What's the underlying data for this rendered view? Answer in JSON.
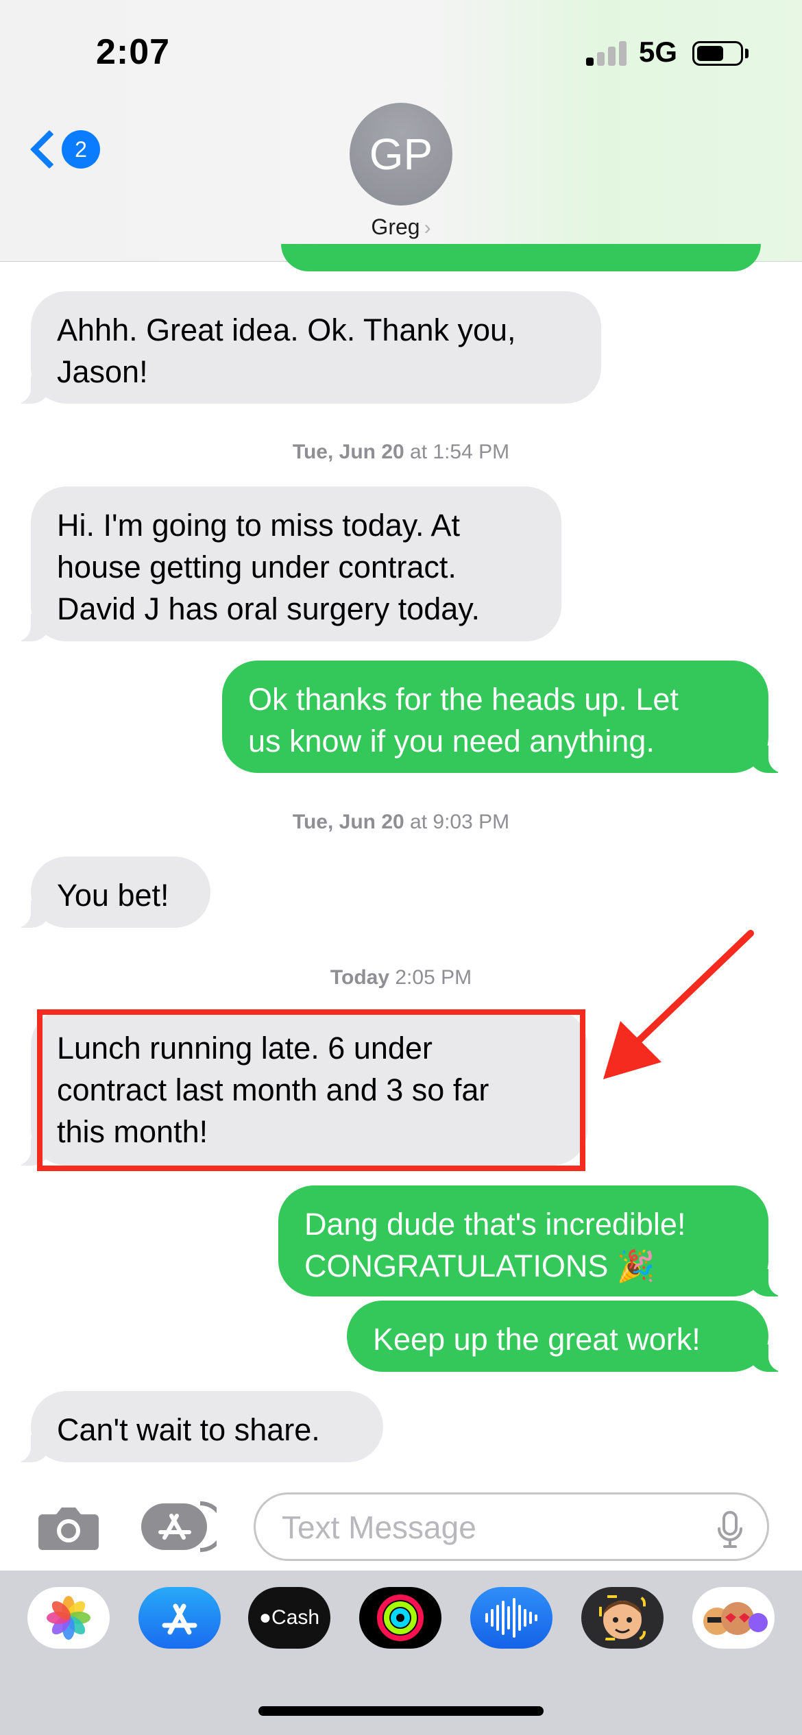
{
  "status_bar": {
    "time": "2:07",
    "network": "5G"
  },
  "header": {
    "back_badge": "2",
    "avatar_initials": "GP",
    "contact_name": "Greg"
  },
  "messages": [
    {
      "kind": "in",
      "text": "Ahhh. Great idea. Ok. Thank you,\nJason!"
    },
    {
      "kind": "timestamp",
      "day": "Tue, Jun 20",
      "time": " at 1:54 PM"
    },
    {
      "kind": "in",
      "text": "Hi. I'm going to miss today. At\nhouse getting under contract.\nDavid J has oral surgery today."
    },
    {
      "kind": "out",
      "text": "Ok thanks for the heads up. Let\nus know if you need anything."
    },
    {
      "kind": "timestamp",
      "day": "Tue, Jun 20",
      "time": " at 9:03 PM"
    },
    {
      "kind": "in",
      "text": "You bet!"
    },
    {
      "kind": "timestamp",
      "day": "Today",
      "time": " 2:05 PM"
    },
    {
      "kind": "in",
      "text": "Lunch running late. 6 under\ncontract last month and 3 so far\nthis month!"
    },
    {
      "kind": "out",
      "text": "Dang dude that's incredible!\nCONGRATULATIONS 🎉"
    },
    {
      "kind": "out",
      "text": "Keep up the great work!"
    },
    {
      "kind": "in",
      "text": "Can't wait to share."
    }
  ],
  "composer": {
    "placeholder": "Text Message"
  },
  "app_drawer": [
    {
      "name": "Photos",
      "icon": "photos-icon"
    },
    {
      "name": "App Store",
      "icon": "app-store-icon"
    },
    {
      "name": "Cash",
      "label": "Cash",
      "icon": "apple-cash-icon"
    },
    {
      "name": "Fitness",
      "icon": "activity-rings-icon"
    },
    {
      "name": "Audio Message",
      "icon": "waveform-icon"
    },
    {
      "name": "Memoji",
      "icon": "memoji-icon"
    },
    {
      "name": "Memoji Stickers",
      "icon": "memoji-stickers-icon"
    }
  ],
  "colors": {
    "accent": "#0a7cff",
    "sent_bubble": "#34c759",
    "received_bubble": "#e9e9eb",
    "annotation": "#f42b1e"
  }
}
